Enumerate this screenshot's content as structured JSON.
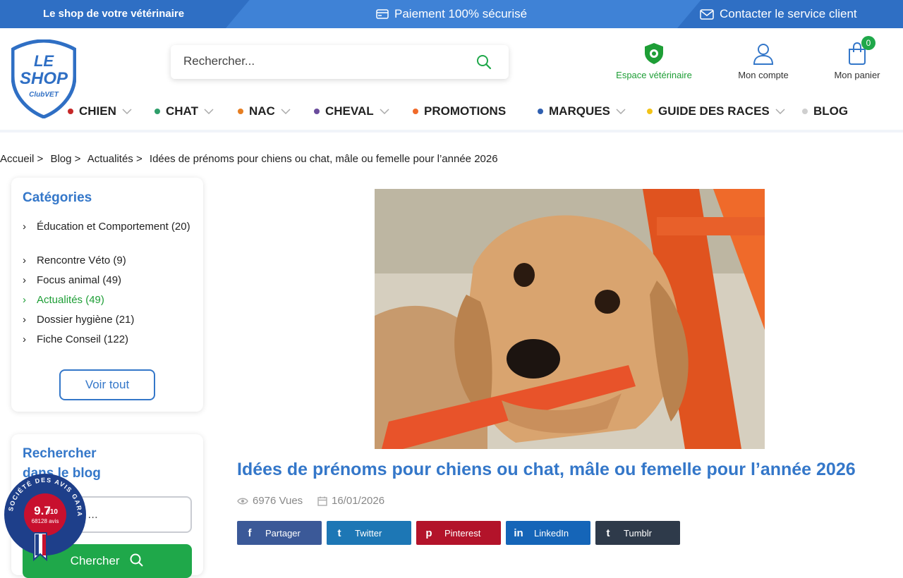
{
  "topbar": {
    "left": "Le shop de votre vétérinaire",
    "center": "Paiement 100% sécurisé",
    "right": "Contacter le service client"
  },
  "logo": {
    "line1": "LE",
    "line2": "SHOP",
    "line3": "ClubVET"
  },
  "search": {
    "placeholder": "Rechercher..."
  },
  "header": {
    "vet_label": "Espace vétérinaire",
    "account_label": "Mon compte",
    "cart_label": "Mon panier",
    "cart_count": "0"
  },
  "nav": {
    "items": [
      {
        "label": "CHIEN",
        "color": "#c62828",
        "dropdown": true
      },
      {
        "label": "CHAT",
        "color": "#2e9e6a",
        "dropdown": true
      },
      {
        "label": "NAC",
        "color": "#e67e22",
        "dropdown": true
      },
      {
        "label": "CHEVAL",
        "color": "#6a4c9c",
        "dropdown": true
      },
      {
        "label": "PROMOTIONS",
        "color": "#f06a2a",
        "dropdown": false
      },
      {
        "label": "MARQUES",
        "color": "#2f5fb0",
        "dropdown": true
      },
      {
        "label": "GUIDE DES RACES",
        "color": "#f2c318",
        "dropdown": true
      },
      {
        "label": "BLOG",
        "color": "#cfcfcf",
        "dropdown": false
      }
    ]
  },
  "breadcrumb": {
    "items": [
      "Accueil >",
      "Blog >",
      "Actualités >",
      "Idées de prénoms pour chiens ou chat, mâle ou femelle pour l’année 2026"
    ]
  },
  "sidebar": {
    "categories_title": "Catégories",
    "categories": [
      {
        "label": "Éducation et Comportement (20)",
        "active": false
      },
      {
        "label": "Rencontre Véto (9)",
        "active": false
      },
      {
        "label": "Focus animal (49)",
        "active": false
      },
      {
        "label": "Actualités (49)",
        "active": true
      },
      {
        "label": "Dossier hygiène (21)",
        "active": false
      },
      {
        "label": "Fiche Conseil (122)",
        "active": false
      }
    ],
    "voir_tout": "Voir tout",
    "blog_search_title": "Rechercher dans le blog",
    "keyword_placeholder": "Mots clés ...",
    "search_button": "Chercher"
  },
  "avis": {
    "score": "9.7",
    "out_of": "/10",
    "count": "68128 avis",
    "ring_text": "SOCIÉTÉ DES AVIS GARANTIS"
  },
  "article": {
    "title": "Idées de prénoms pour chiens ou chat, mâle ou femelle pour l’année 2026",
    "views": "6976 Vues",
    "date": "16/01/2026",
    "share": [
      {
        "label": "Partager",
        "icon": "f",
        "color": "#3b5998"
      },
      {
        "label": "Twitter",
        "icon": "t",
        "color": "#1d77b5"
      },
      {
        "label": "Pinterest",
        "icon": "p",
        "color": "#b3132a"
      },
      {
        "label": "LinkedIn",
        "icon": "in",
        "color": "#1565b8"
      },
      {
        "label": "Tumblr",
        "icon": "t",
        "color": "#2e3a4a"
      }
    ]
  }
}
